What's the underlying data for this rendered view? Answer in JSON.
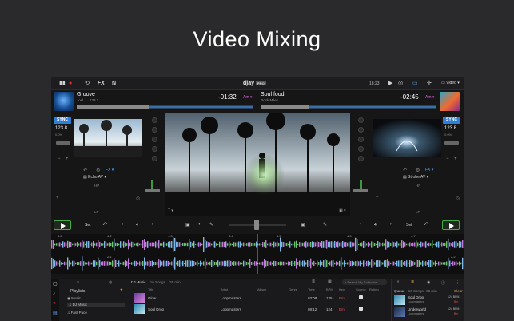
{
  "page": {
    "headline": "Video Mixing"
  },
  "topbar": {
    "logo": "djay",
    "logo_badge": "PRO",
    "clock": "18:23",
    "video_select": "Video",
    "fx_label": "FX",
    "n_label": "N"
  },
  "deck_left": {
    "title": "Groove",
    "artist": "Joel",
    "bpm_small": "138.3",
    "time": "-01:32",
    "key": "Am",
    "sync": "SYNC",
    "bpm": "123.8",
    "bpm_sub": "0.0%",
    "fx": "FX",
    "effect": "Echo AV",
    "hp": "HP",
    "lp": "LP",
    "set": "Set",
    "loop": "4"
  },
  "deck_right": {
    "title": "Soul food",
    "artist": "Rock Miles",
    "time": "-02:45",
    "key": "Am",
    "sync": "SYNC",
    "bpm": "123.8",
    "bpm_sub": "0.0%",
    "fx": "FX",
    "effect": "Strobe AV",
    "hp": "HP",
    "lp": "LP",
    "set": "Set",
    "loop": "4"
  },
  "waveform_markers": [
    "4.2",
    "4.3",
    "4.4",
    "4.5",
    "4.6",
    "4.7",
    "2.1",
    "2.2"
  ],
  "library": {
    "source": "DJ Music",
    "count": "16 Songs",
    "duration": "38 min",
    "search_placeholder": "Search My Collection",
    "sidebar_title": "Playlists",
    "sidebar_items": [
      "Music",
      "DJ Music",
      "Fast Pace"
    ],
    "columns": [
      "Title",
      "Artist",
      "Album",
      "Genre",
      "Time",
      "BPM",
      "Key",
      "Source",
      "Rating"
    ],
    "rows": [
      {
        "title": "Glow",
        "artist": "Loopmasters",
        "time": "03:08",
        "bpm": "125",
        "key": "Bm"
      },
      {
        "title": "Soul Drop",
        "artist": "Loopmasters",
        "time": "08:12",
        "bpm": "124",
        "key": "Bm"
      }
    ],
    "queue_title": "Queue",
    "queue_count": "16 Songs",
    "queue_duration": "68 min",
    "queue_clear": "Clear",
    "queue_items": [
      {
        "title": "Soul Drop",
        "artist": "Loopmasters",
        "bpm": "124 BPM",
        "key": "Bm"
      },
      {
        "title": "Underworld",
        "artist": "Loopmasters",
        "bpm": "124 BPM",
        "key": "Bm"
      }
    ]
  },
  "colors": {
    "accent": "#2f7fd6",
    "key": "#d46ad6",
    "play": "#44aa44"
  }
}
